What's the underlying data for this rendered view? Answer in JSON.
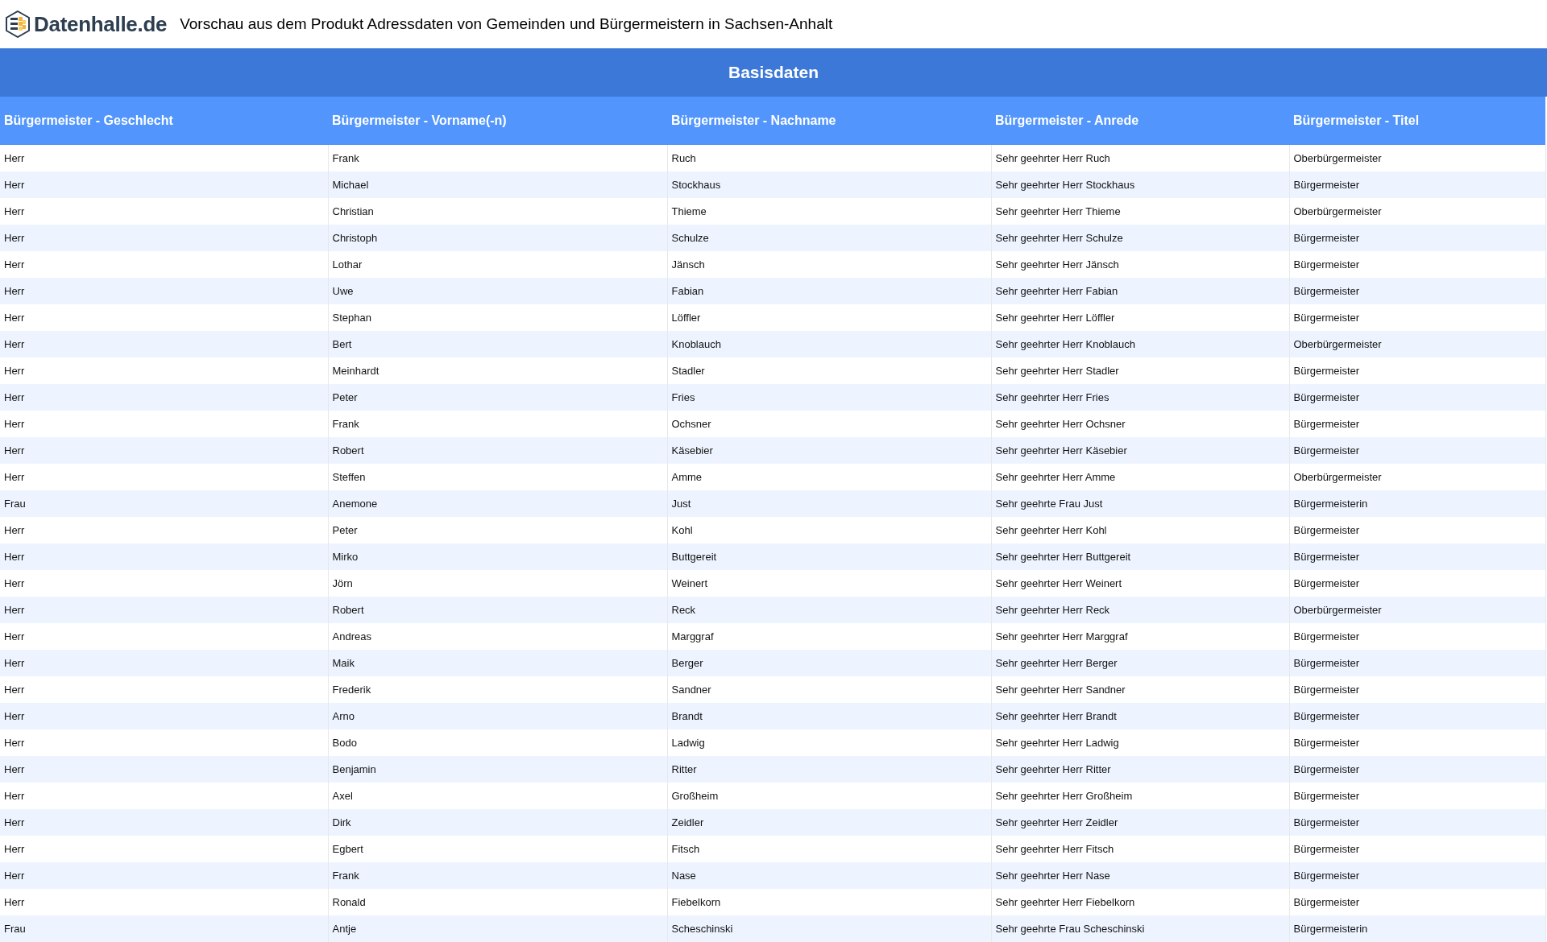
{
  "header": {
    "logo_text": "Datenhalle.de",
    "title": "Vorschau aus dem Produkt Adressdaten von Gemeinden und Bürgermeistern in Sachsen-Anhalt"
  },
  "section_title": "Basisdaten",
  "table": {
    "columns": [
      "Bürgermeister - Geschlecht",
      "Bürgermeister - Vorname(-n)",
      "Bürgermeister - Nachname",
      "Bürgermeister - Anrede",
      "Bürgermeister - Titel"
    ],
    "rows": [
      [
        "Herr",
        "Frank",
        "Ruch",
        "Sehr geehrter Herr Ruch",
        "Oberbürgermeister"
      ],
      [
        "Herr",
        "Michael",
        "Stockhaus",
        "Sehr geehrter Herr Stockhaus",
        "Bürgermeister"
      ],
      [
        "Herr",
        "Christian",
        "Thieme",
        "Sehr geehrter Herr Thieme",
        "Oberbürgermeister"
      ],
      [
        "Herr",
        "Christoph",
        "Schulze",
        "Sehr geehrter Herr Schulze",
        "Bürgermeister"
      ],
      [
        "Herr",
        "Lothar",
        "Jänsch",
        "Sehr geehrter Herr Jänsch",
        "Bürgermeister"
      ],
      [
        "Herr",
        "Uwe",
        "Fabian",
        "Sehr geehrter Herr Fabian",
        "Bürgermeister"
      ],
      [
        "Herr",
        "Stephan",
        "Löffler",
        "Sehr geehrter Herr Löffler",
        "Bürgermeister"
      ],
      [
        "Herr",
        "Bert",
        "Knoblauch",
        "Sehr geehrter Herr Knoblauch",
        "Oberbürgermeister"
      ],
      [
        "Herr",
        "Meinhardt",
        "Stadler",
        "Sehr geehrter Herr Stadler",
        "Bürgermeister"
      ],
      [
        "Herr",
        "Peter",
        "Fries",
        "Sehr geehrter Herr Fries",
        "Bürgermeister"
      ],
      [
        "Herr",
        "Frank",
        "Ochsner",
        "Sehr geehrter Herr Ochsner",
        "Bürgermeister"
      ],
      [
        "Herr",
        "Robert",
        "Käsebier",
        "Sehr geehrter Herr Käsebier",
        "Bürgermeister"
      ],
      [
        "Herr",
        "Steffen",
        "Amme",
        "Sehr geehrter Herr Amme",
        "Oberbürgermeister"
      ],
      [
        "Frau",
        "Anemone",
        "Just",
        "Sehr geehrte Frau Just",
        "Bürgermeisterin"
      ],
      [
        "Herr",
        "Peter",
        "Kohl",
        "Sehr geehrter Herr Kohl",
        "Bürgermeister"
      ],
      [
        "Herr",
        "Mirko",
        "Buttgereit",
        "Sehr geehrter Herr Buttgereit",
        "Bürgermeister"
      ],
      [
        "Herr",
        "Jörn",
        "Weinert",
        "Sehr geehrter Herr Weinert",
        "Bürgermeister"
      ],
      [
        "Herr",
        "Robert",
        "Reck",
        "Sehr geehrter Herr Reck",
        "Oberbürgermeister"
      ],
      [
        "Herr",
        "Andreas",
        "Marggraf",
        "Sehr geehrter Herr Marggraf",
        "Bürgermeister"
      ],
      [
        "Herr",
        "Maik",
        "Berger",
        "Sehr geehrter Herr Berger",
        "Bürgermeister"
      ],
      [
        "Herr",
        "Frederik",
        "Sandner",
        "Sehr geehrter Herr Sandner",
        "Bürgermeister"
      ],
      [
        "Herr",
        "Arno",
        "Brandt",
        "Sehr geehrter Herr Brandt",
        "Bürgermeister"
      ],
      [
        "Herr",
        "Bodo",
        "Ladwig",
        "Sehr geehrter Herr Ladwig",
        "Bürgermeister"
      ],
      [
        "Herr",
        "Benjamin",
        "Ritter",
        "Sehr geehrter Herr Ritter",
        "Bürgermeister"
      ],
      [
        "Herr",
        "Axel",
        "Großheim",
        "Sehr geehrter Herr Großheim",
        "Bürgermeister"
      ],
      [
        "Herr",
        "Dirk",
        "Zeidler",
        "Sehr geehrter Herr Zeidler",
        "Bürgermeister"
      ],
      [
        "Herr",
        "Egbert",
        "Fitsch",
        "Sehr geehrter Herr Fitsch",
        "Bürgermeister"
      ],
      [
        "Herr",
        "Frank",
        "Nase",
        "Sehr geehrter Herr Nase",
        "Bürgermeister"
      ],
      [
        "Herr",
        "Ronald",
        "Fiebelkorn",
        "Sehr geehrter Herr Fiebelkorn",
        "Bürgermeister"
      ],
      [
        "Frau",
        "Antje",
        "Scheschinski",
        "Sehr geehrte Frau Scheschinski",
        "Bürgermeisterin"
      ]
    ]
  }
}
